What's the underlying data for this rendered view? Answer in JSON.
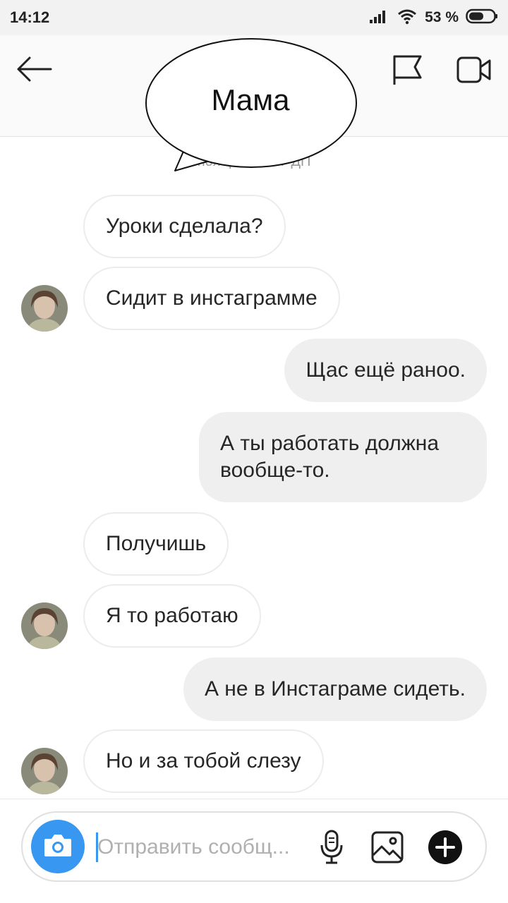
{
  "status_bar": {
    "time": "14:12",
    "battery": "53 %",
    "icons": [
      "signal-icon",
      "wifi-icon",
      "battery-icon"
    ]
  },
  "header": {
    "back_icon": "arrow-left-icon",
    "title": "Мама",
    "actions": [
      "flag-icon",
      "video-camera-icon"
    ]
  },
  "timestamp": "ноября, 14:07 ДП",
  "messages": [
    {
      "side": "in",
      "text": "Уроки сделала?"
    },
    {
      "side": "in",
      "text": "Сидит в инстаграмме",
      "avatar": true
    },
    {
      "side": "out",
      "text": "Щас ещё раноо."
    },
    {
      "side": "out",
      "text": "А ты работать должна вообще-то."
    },
    {
      "side": "in",
      "text": "Получишь"
    },
    {
      "side": "in",
      "text": "Я то работаю",
      "avatar": true
    },
    {
      "side": "out",
      "text": "А не в Инстаграме сидеть."
    },
    {
      "side": "in",
      "text": "Но и за тобой слезу",
      "avatar": true
    }
  ],
  "composer": {
    "placeholder": "Отправить сообщ...",
    "value": "",
    "icons": [
      "camera-icon",
      "microphone-icon",
      "gallery-icon",
      "plus-icon"
    ]
  },
  "colors": {
    "accent": "#3897f0",
    "outgoing_bubble": "#efefef",
    "incoming_border": "#ececec",
    "status_bar_bg": "#f2f2f2"
  }
}
